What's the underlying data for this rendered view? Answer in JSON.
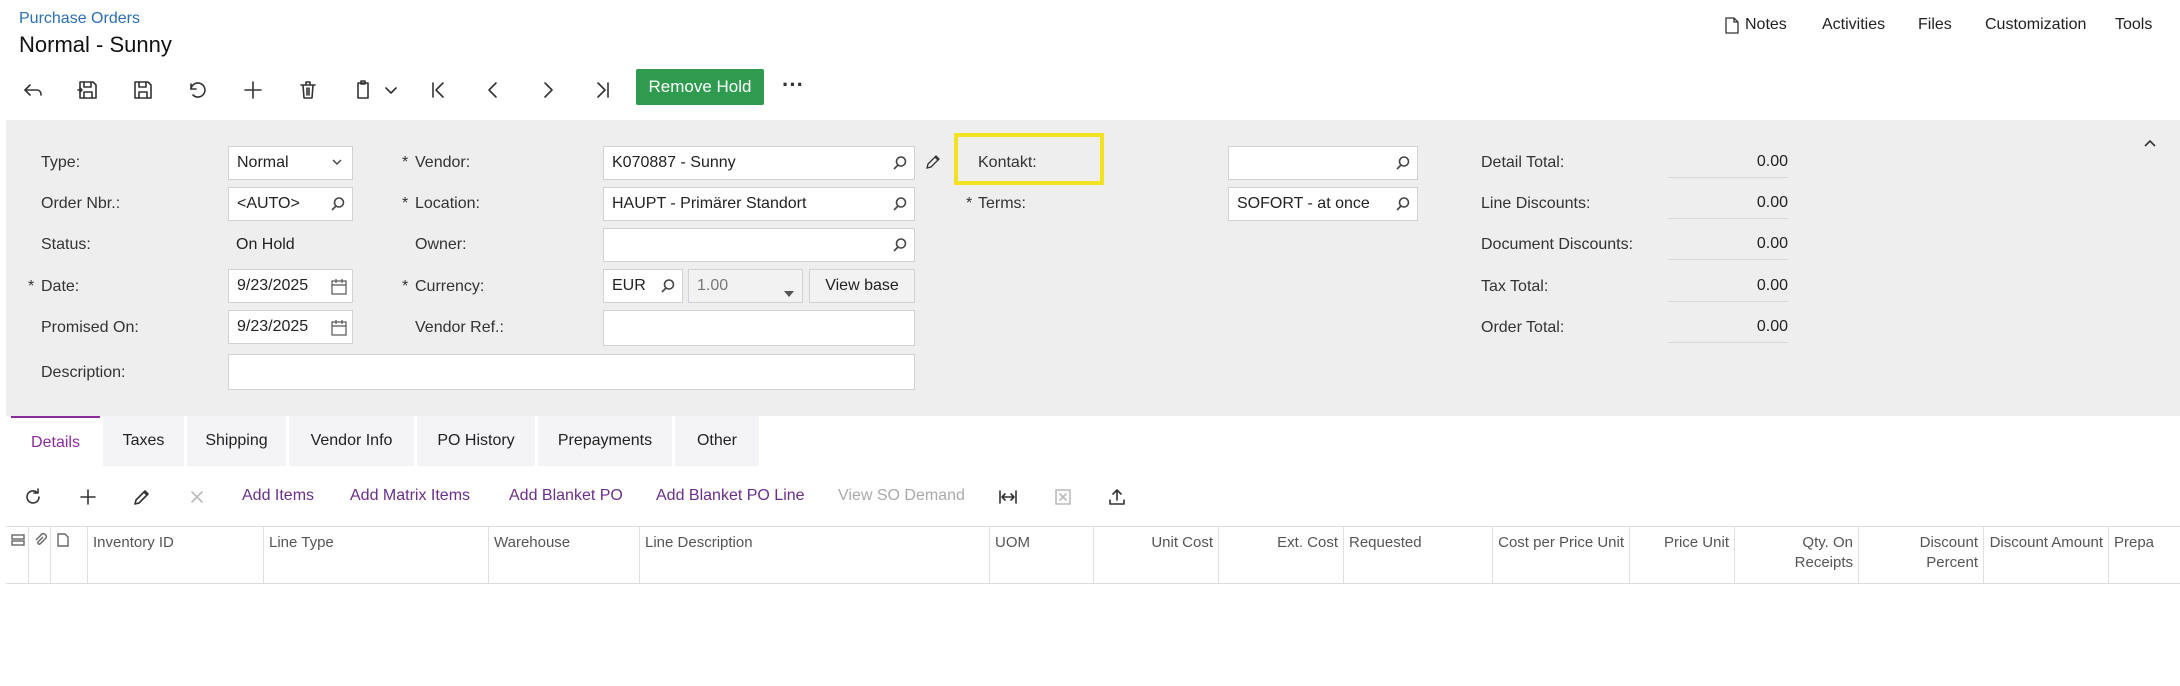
{
  "header": {
    "breadcrumb": "Purchase Orders",
    "title": "Normal - Sunny",
    "nav": {
      "notes": "Notes",
      "activities": "Activities",
      "files": "Files",
      "customization": "Customization",
      "tools": "Tools"
    }
  },
  "toolbar": {
    "remove_hold": "Remove Hold",
    "more": "···"
  },
  "form": {
    "type": {
      "label": "Type:",
      "value": "Normal"
    },
    "order_nbr": {
      "label": "Order Nbr.:",
      "value": "<AUTO>"
    },
    "status": {
      "label": "Status:",
      "value": "On Hold"
    },
    "date": {
      "label": "Date:",
      "value": "9/23/2025"
    },
    "promised_on": {
      "label": "Promised On:",
      "value": "9/23/2025"
    },
    "description": {
      "label": "Description:",
      "value": ""
    },
    "vendor": {
      "label": "Vendor:",
      "value": "K070887 - Sunny"
    },
    "location": {
      "label": "Location:",
      "value": "HAUPT - Primärer Standort"
    },
    "owner": {
      "label": "Owner:",
      "value": ""
    },
    "currency": {
      "label": "Currency:",
      "value": "EUR",
      "rate": "1.00",
      "view_base": "View base"
    },
    "vendor_ref": {
      "label": "Vendor Ref.:",
      "value": ""
    },
    "kontakt": {
      "label": "Kontakt:",
      "value": ""
    },
    "terms": {
      "label": "Terms:",
      "value": "SOFORT - at once"
    },
    "required_mark": "*"
  },
  "summary": {
    "detail_total": {
      "label": "Detail Total:",
      "value": "0.00"
    },
    "line_discounts": {
      "label": "Line Discounts:",
      "value": "0.00"
    },
    "document_discounts": {
      "label": "Document Discounts:",
      "value": "0.00"
    },
    "tax_total": {
      "label": "Tax Total:",
      "value": "0.00"
    },
    "order_total": {
      "label": "Order Total:",
      "value": "0.00"
    }
  },
  "tabs": [
    "Details",
    "Taxes",
    "Shipping",
    "Vendor Info",
    "PO History",
    "Prepayments",
    "Other"
  ],
  "grid_toolbar": {
    "add_items": "Add Items",
    "add_matrix_items": "Add Matrix Items",
    "add_blanket_po": "Add Blanket PO",
    "add_blanket_po_line": "Add Blanket PO Line",
    "view_so_demand": "View SO Demand"
  },
  "grid_columns": {
    "inventory_id": "Inventory ID",
    "line_type": "Line Type",
    "warehouse": "Warehouse",
    "line_description": "Line Description",
    "uom": "UOM",
    "unit_cost": "Unit Cost",
    "ext_cost": "Ext. Cost",
    "requested": "Requested",
    "cost_per_price_unit": "Cost per Price Unit",
    "price_unit": "Price Unit",
    "qty_on_receipts": "Qty. On Receipts",
    "discount_percent": "Discount Percent",
    "discount_amount": "Discount Amount",
    "prepa": "Prepa"
  },
  "colors": {
    "accent": "#8b2d9c",
    "link": "#2a6fb5",
    "remove_hold": "#2e9b4e",
    "highlight": "#f3e221"
  }
}
